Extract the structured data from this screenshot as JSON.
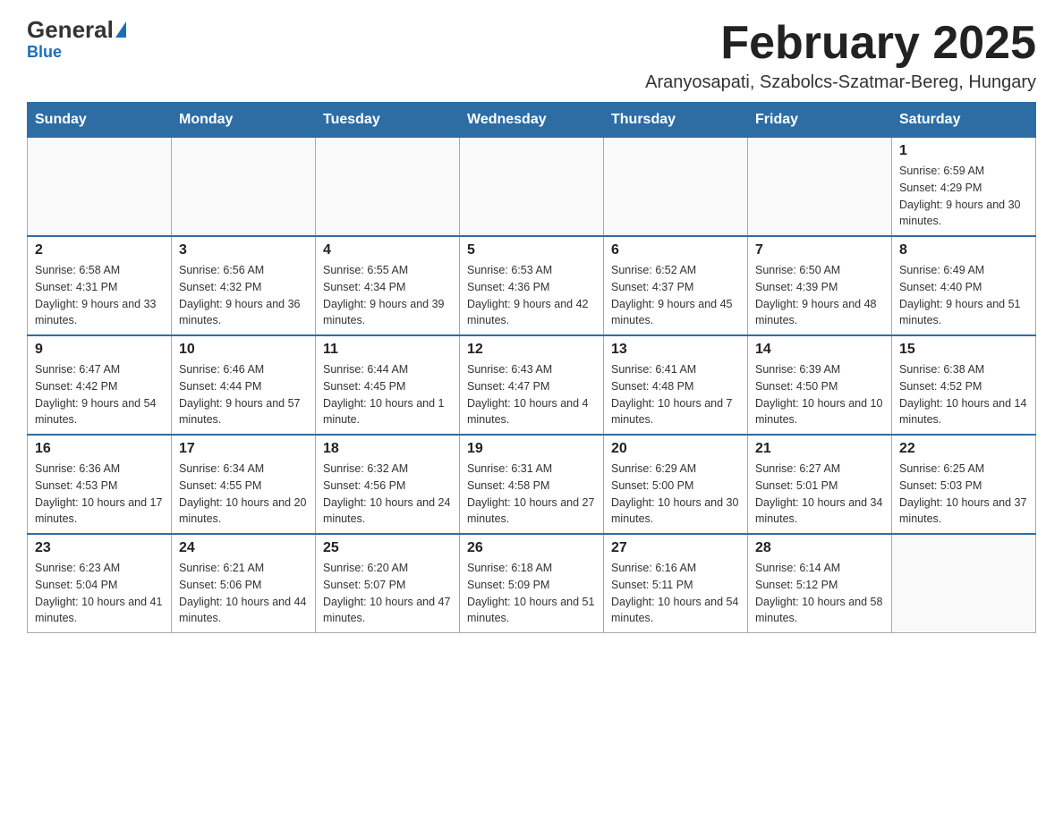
{
  "header": {
    "logo_main": "General",
    "logo_sub": "Blue",
    "month_title": "February 2025",
    "location": "Aranyosapati, Szabolcs-Szatmar-Bereg, Hungary"
  },
  "weekdays": [
    "Sunday",
    "Monday",
    "Tuesday",
    "Wednesday",
    "Thursday",
    "Friday",
    "Saturday"
  ],
  "weeks": [
    [
      {
        "day": "",
        "info": ""
      },
      {
        "day": "",
        "info": ""
      },
      {
        "day": "",
        "info": ""
      },
      {
        "day": "",
        "info": ""
      },
      {
        "day": "",
        "info": ""
      },
      {
        "day": "",
        "info": ""
      },
      {
        "day": "1",
        "info": "Sunrise: 6:59 AM\nSunset: 4:29 PM\nDaylight: 9 hours and 30 minutes."
      }
    ],
    [
      {
        "day": "2",
        "info": "Sunrise: 6:58 AM\nSunset: 4:31 PM\nDaylight: 9 hours and 33 minutes."
      },
      {
        "day": "3",
        "info": "Sunrise: 6:56 AM\nSunset: 4:32 PM\nDaylight: 9 hours and 36 minutes."
      },
      {
        "day": "4",
        "info": "Sunrise: 6:55 AM\nSunset: 4:34 PM\nDaylight: 9 hours and 39 minutes."
      },
      {
        "day": "5",
        "info": "Sunrise: 6:53 AM\nSunset: 4:36 PM\nDaylight: 9 hours and 42 minutes."
      },
      {
        "day": "6",
        "info": "Sunrise: 6:52 AM\nSunset: 4:37 PM\nDaylight: 9 hours and 45 minutes."
      },
      {
        "day": "7",
        "info": "Sunrise: 6:50 AM\nSunset: 4:39 PM\nDaylight: 9 hours and 48 minutes."
      },
      {
        "day": "8",
        "info": "Sunrise: 6:49 AM\nSunset: 4:40 PM\nDaylight: 9 hours and 51 minutes."
      }
    ],
    [
      {
        "day": "9",
        "info": "Sunrise: 6:47 AM\nSunset: 4:42 PM\nDaylight: 9 hours and 54 minutes."
      },
      {
        "day": "10",
        "info": "Sunrise: 6:46 AM\nSunset: 4:44 PM\nDaylight: 9 hours and 57 minutes."
      },
      {
        "day": "11",
        "info": "Sunrise: 6:44 AM\nSunset: 4:45 PM\nDaylight: 10 hours and 1 minute."
      },
      {
        "day": "12",
        "info": "Sunrise: 6:43 AM\nSunset: 4:47 PM\nDaylight: 10 hours and 4 minutes."
      },
      {
        "day": "13",
        "info": "Sunrise: 6:41 AM\nSunset: 4:48 PM\nDaylight: 10 hours and 7 minutes."
      },
      {
        "day": "14",
        "info": "Sunrise: 6:39 AM\nSunset: 4:50 PM\nDaylight: 10 hours and 10 minutes."
      },
      {
        "day": "15",
        "info": "Sunrise: 6:38 AM\nSunset: 4:52 PM\nDaylight: 10 hours and 14 minutes."
      }
    ],
    [
      {
        "day": "16",
        "info": "Sunrise: 6:36 AM\nSunset: 4:53 PM\nDaylight: 10 hours and 17 minutes."
      },
      {
        "day": "17",
        "info": "Sunrise: 6:34 AM\nSunset: 4:55 PM\nDaylight: 10 hours and 20 minutes."
      },
      {
        "day": "18",
        "info": "Sunrise: 6:32 AM\nSunset: 4:56 PM\nDaylight: 10 hours and 24 minutes."
      },
      {
        "day": "19",
        "info": "Sunrise: 6:31 AM\nSunset: 4:58 PM\nDaylight: 10 hours and 27 minutes."
      },
      {
        "day": "20",
        "info": "Sunrise: 6:29 AM\nSunset: 5:00 PM\nDaylight: 10 hours and 30 minutes."
      },
      {
        "day": "21",
        "info": "Sunrise: 6:27 AM\nSunset: 5:01 PM\nDaylight: 10 hours and 34 minutes."
      },
      {
        "day": "22",
        "info": "Sunrise: 6:25 AM\nSunset: 5:03 PM\nDaylight: 10 hours and 37 minutes."
      }
    ],
    [
      {
        "day": "23",
        "info": "Sunrise: 6:23 AM\nSunset: 5:04 PM\nDaylight: 10 hours and 41 minutes."
      },
      {
        "day": "24",
        "info": "Sunrise: 6:21 AM\nSunset: 5:06 PM\nDaylight: 10 hours and 44 minutes."
      },
      {
        "day": "25",
        "info": "Sunrise: 6:20 AM\nSunset: 5:07 PM\nDaylight: 10 hours and 47 minutes."
      },
      {
        "day": "26",
        "info": "Sunrise: 6:18 AM\nSunset: 5:09 PM\nDaylight: 10 hours and 51 minutes."
      },
      {
        "day": "27",
        "info": "Sunrise: 6:16 AM\nSunset: 5:11 PM\nDaylight: 10 hours and 54 minutes."
      },
      {
        "day": "28",
        "info": "Sunrise: 6:14 AM\nSunset: 5:12 PM\nDaylight: 10 hours and 58 minutes."
      },
      {
        "day": "",
        "info": ""
      }
    ]
  ]
}
